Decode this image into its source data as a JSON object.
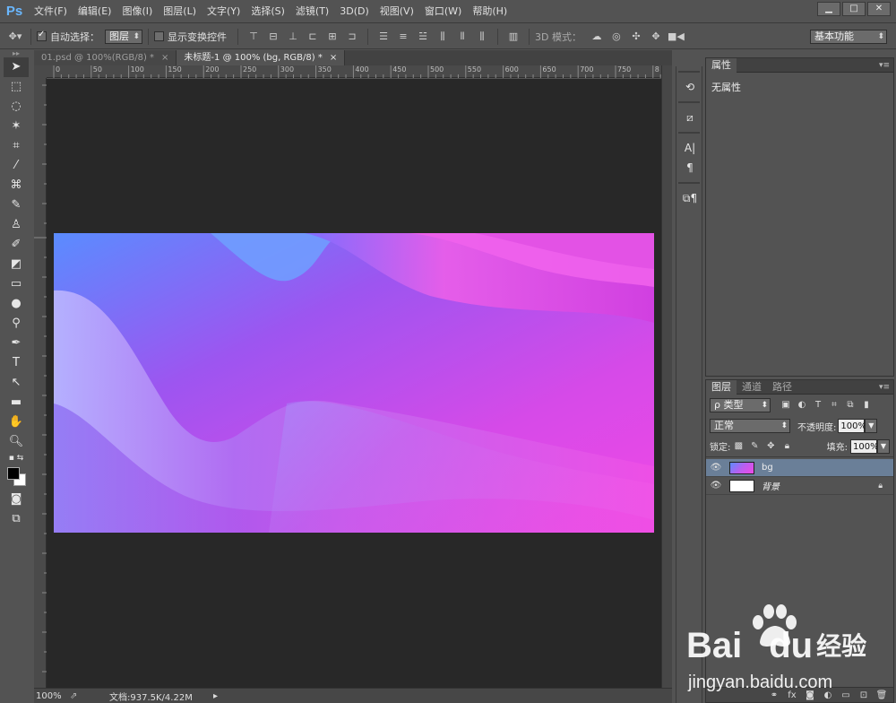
{
  "app": {
    "logo": "Ps",
    "menu": [
      "文件(F)",
      "编辑(E)",
      "图像(I)",
      "图层(L)",
      "文字(Y)",
      "选择(S)",
      "滤镜(T)",
      "3D(D)",
      "视图(V)",
      "窗口(W)",
      "帮助(H)"
    ],
    "window_controls": [
      "▁",
      "□",
      "✕"
    ]
  },
  "options": {
    "auto_select_label": "自动选择：",
    "auto_select_checked": true,
    "auto_select_value": "图层",
    "show_transform_label": "显示变换控件",
    "show_transform_checked": false,
    "mode_3d_label": "3D 模式：",
    "workspace": "基本功能"
  },
  "tabs": [
    {
      "label": "01.psd @ 100%(RGB/8) *",
      "close": "×",
      "active": false
    },
    {
      "label": "未标题-1 @ 100% (bg, RGB/8) *",
      "close": "×",
      "active": true
    }
  ],
  "ruler": {
    "top_labels": [
      "0",
      "50",
      "100",
      "150",
      "200",
      "250",
      "300",
      "350",
      "400",
      "450",
      "500",
      "550",
      "600",
      "650",
      "700",
      "750",
      "8"
    ]
  },
  "status": {
    "zoom": "100%",
    "doc_info": "文档:937.5K/4.22M"
  },
  "properties": {
    "tab": "属性",
    "empty_text": "无属性"
  },
  "layers_panel": {
    "tabs": [
      "图层",
      "通道",
      "路径"
    ],
    "filter_label": "ρ 类型",
    "blend_mode": "正常",
    "opacity_label": "不透明度:",
    "opacity_value": "100%",
    "lock_label": "锁定:",
    "fill_label": "填充:",
    "fill_value": "100%",
    "layers": [
      {
        "name": "bg",
        "selected": true
      },
      {
        "name": "背景",
        "selected": false,
        "locked": true
      }
    ]
  },
  "watermark": {
    "brand_latin": "Bai",
    "brand_du": "du",
    "brand_cn": "经验",
    "url": "jingyan.baidu.com"
  },
  "colors": {
    "artboard_blue": "#5a8cff",
    "artboard_purple": "#a54bf0",
    "artboard_magenta": "#f048e6",
    "layer_selected": "#6a7f98"
  }
}
